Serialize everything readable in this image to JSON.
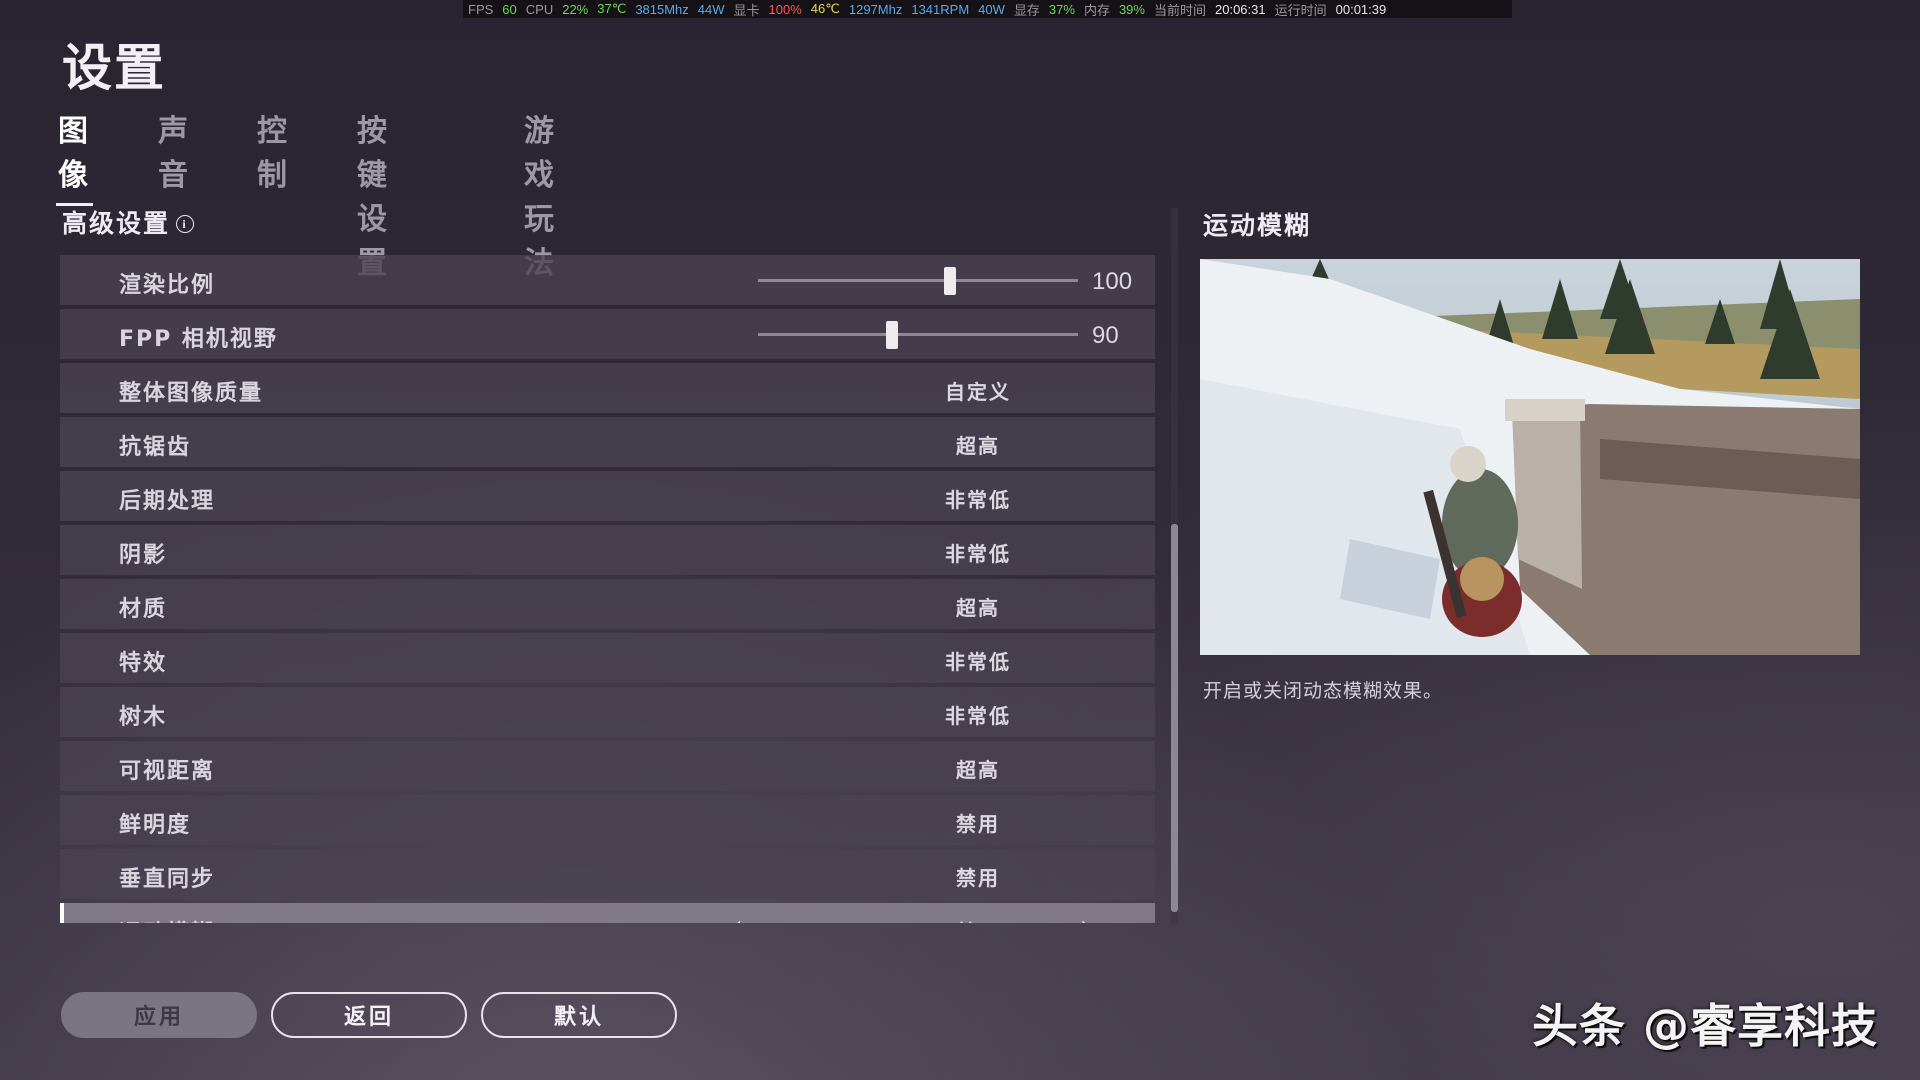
{
  "hud": {
    "fps_label": "FPS",
    "fps": "60",
    "cpu_label": "CPU",
    "cpu_load": "22%",
    "cpu_temp": "37℃",
    "cpu_clock": "3815Mhz",
    "cpu_power": "44W",
    "gpu_label": "显卡",
    "gpu_load": "100%",
    "gpu_temp": "46℃",
    "gpu_clock": "1297Mhz",
    "gpu_fan": "1341RPM",
    "gpu_power": "40W",
    "vram_label": "显存",
    "vram": "37%",
    "ram_label": "内存",
    "ram": "39%",
    "time_label": "当前时间",
    "time": "20:06:31",
    "runtime_label": "运行时间",
    "runtime": "00:01:39"
  },
  "page_title": "设置",
  "tabs": [
    {
      "label": "图像",
      "active": true
    },
    {
      "label": "声音",
      "active": false
    },
    {
      "label": "控制",
      "active": false
    },
    {
      "label": "按键设置",
      "active": false
    },
    {
      "label": "游戏玩法",
      "active": false
    }
  ],
  "section_title": "高级设置",
  "info_icon_glyph": "i",
  "settings": [
    {
      "label": "渲染比例",
      "type": "slider",
      "value": "100",
      "fraction": 0.6
    },
    {
      "label": "FPP 相机视野",
      "type": "slider",
      "value": "90",
      "fraction": 0.42
    },
    {
      "label": "整体图像质量",
      "type": "option",
      "value": "自定义"
    },
    {
      "label": "抗锯齿",
      "type": "option",
      "value": "超高"
    },
    {
      "label": "后期处理",
      "type": "option",
      "value": "非常低"
    },
    {
      "label": "阴影",
      "type": "option",
      "value": "非常低"
    },
    {
      "label": "材质",
      "type": "option",
      "value": "超高"
    },
    {
      "label": "特效",
      "type": "option",
      "value": "非常低"
    },
    {
      "label": "树木",
      "type": "option",
      "value": "非常低"
    },
    {
      "label": "可视距离",
      "type": "option",
      "value": "超高"
    },
    {
      "label": "鲜明度",
      "type": "option",
      "value": "禁用"
    },
    {
      "label": "垂直同步",
      "type": "option",
      "value": "禁用"
    },
    {
      "label": "运动模糊",
      "type": "option",
      "value": "禁用",
      "selected": true
    }
  ],
  "preview": {
    "title": "运动模糊",
    "description": "开启或关闭动态模糊效果。"
  },
  "buttons": {
    "apply": "应用",
    "back": "返回",
    "default": "默认"
  },
  "watermark": "头条 @睿享科技",
  "colors": {
    "background": "#2c2634",
    "row_bg": "#4a4351",
    "row_selected": "#86808c",
    "text_primary": "#d9d5dd",
    "hud_green": "#6fd35a",
    "hud_blue": "#5aa9e6",
    "hud_red": "#ff5a4a"
  }
}
